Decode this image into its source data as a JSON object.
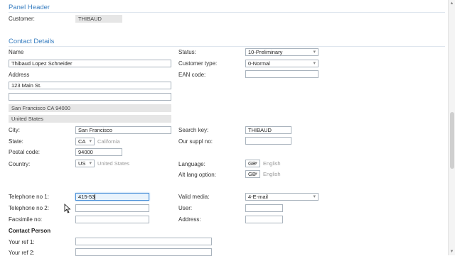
{
  "panel": {
    "title": "Panel Header",
    "customer_label": "Customer:",
    "customer_value": "THIBAUD"
  },
  "contact": {
    "title": "Contact Details",
    "name_label": "Name",
    "name_value": "Thibaud Lopez Schneider",
    "address_label": "Address",
    "address_line1": "123 Main St.",
    "address_line2": "",
    "address_readonly1": "San Francisco CA 94000",
    "address_readonly2": "United States",
    "city_label": "City:",
    "city_value": "San Francisco",
    "state_label": "State:",
    "state_code": "CA",
    "state_name": "California",
    "postal_label": "Postal code:",
    "postal_value": "94000",
    "country_label": "Country:",
    "country_code": "US",
    "country_name": "United States",
    "status_label": "Status:",
    "status_value": "10-Preliminary",
    "customer_type_label": "Customer type:",
    "customer_type_value": "0-Normal",
    "ean_label": "EAN code:",
    "ean_value": "",
    "search_key_label": "Search key:",
    "search_key_value": "THIBAUD",
    "our_suppl_label": "Our suppl no:",
    "our_suppl_value": "",
    "language_label": "Language:",
    "language_code": "GB",
    "language_name": "English",
    "alt_lang_label": "Alt lang option:",
    "alt_lang_code": "GB",
    "alt_lang_name": "English",
    "tel1_label": "Telephone no 1:",
    "tel1_value": "415-53",
    "tel2_label": "Telephone no 2:",
    "tel2_value": "",
    "fax_label": "Facsimile no:",
    "fax_value": "",
    "valid_media_label": "Valid media:",
    "valid_media_value": "4-E-mail",
    "user_label": "User:",
    "user_value": "",
    "address2_label": "Address:",
    "address2_value": ""
  },
  "contact_person": {
    "title": "Contact Person",
    "ref1_label": "Your ref 1:",
    "ref1_value": "",
    "ref2_label": "Your ref 2:",
    "ref2_value": ""
  }
}
